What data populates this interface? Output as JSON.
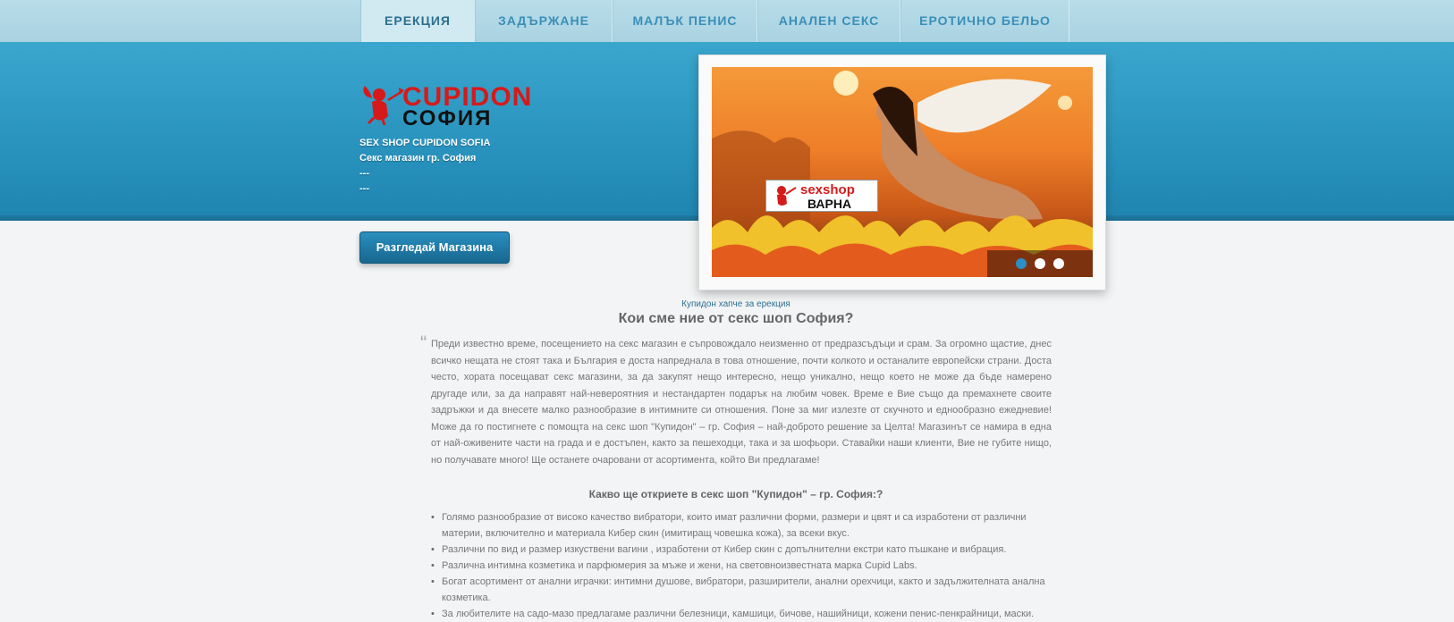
{
  "nav": {
    "items": [
      {
        "label": "ЕРЕКЦИЯ",
        "active": true
      },
      {
        "label": "ЗАДЪРЖАНЕ",
        "active": false
      },
      {
        "label": "МАЛЪК ПЕНИС",
        "active": false
      },
      {
        "label": "АНАЛЕН СЕКС",
        "active": false
      },
      {
        "label": "ЕРОТИЧНО БЕЛЬО",
        "active": false
      }
    ]
  },
  "logo": {
    "brand": "CUPIDON",
    "city": "СОФИЯ"
  },
  "hero": {
    "line1": "SEX SHOP CUPIDON SOFIA",
    "line2": "Секс магазин гр. София",
    "line3": "---",
    "line4": "---"
  },
  "shop_button": "Разгледай Магазина",
  "slider": {
    "badge_top": "sexshop",
    "badge_bottom": "ВАРНА",
    "active_dot": 1,
    "dot_count": 3
  },
  "content": {
    "caption": "Купидон хапче за ерекция",
    "title": "Кои сме ние от секс шоп София?",
    "quote_mark": "“",
    "paragraph": "Преди известно време, посещението на секс магазин е съпровождало неизменно от предразсъдъци и срам. За огромно щастие, днес всичко нещата не стоят така и България е доста напреднала в това отношение, почти колкото и останалите европейски страни. Доста често, хората посещават секс магазини, за да закупят нещо интересно, нещо уникално, нещо което не може да бъде намерено другаде или, за да направят най-невероятния и нестандартен подарък на любим човек. Време е Вие също да премахнете своите задръжки и да внесете малко разнообразие в интимните си отношения. Поне за миг излезте от скучното и еднообразно ежедневие! Може да го постигнете с помощта на секс шоп \"Купидон\" – гр. София – най-доброто решение за Целта! Магазинът се намира в една от най-оживените части на града и е достъпен, както за пешеходци, така и за шофьори. Ставайки наши клиенти, Вие не губите нищо, но получавате много! Ще останете очаровани от асортимента, който Ви предлагаме!",
    "subtitle": "Какво ще откриете в секс шоп \"Купидон\" – гр. София:?",
    "features": [
      "Голямо разнообразие от високо качество вибратори, които имат различни форми, размери и цвят и са изработени от различни материи, включително и материала Кибер скин (имитиращ човешка кожа), за всеки вкус.",
      "Различни по вид и размер изкуствени вагини , изработени от Кибер скин с допълнителни екстри като пъшкане и вибрация.",
      "Различна интимна козметика и парфюмерия за мъже и жени, на световноизвестната марка Cupid Labs.",
      "Богат асортимент от анални играчки: интимни душове, вибратори, разширители, анални орехчици, както и задължителната анална козметика.",
      "За любителите на садо-мазо предлагаме различни белезници, камшици, бичове, нашийници, кожени пенис-пенкрайници, маски."
    ]
  }
}
